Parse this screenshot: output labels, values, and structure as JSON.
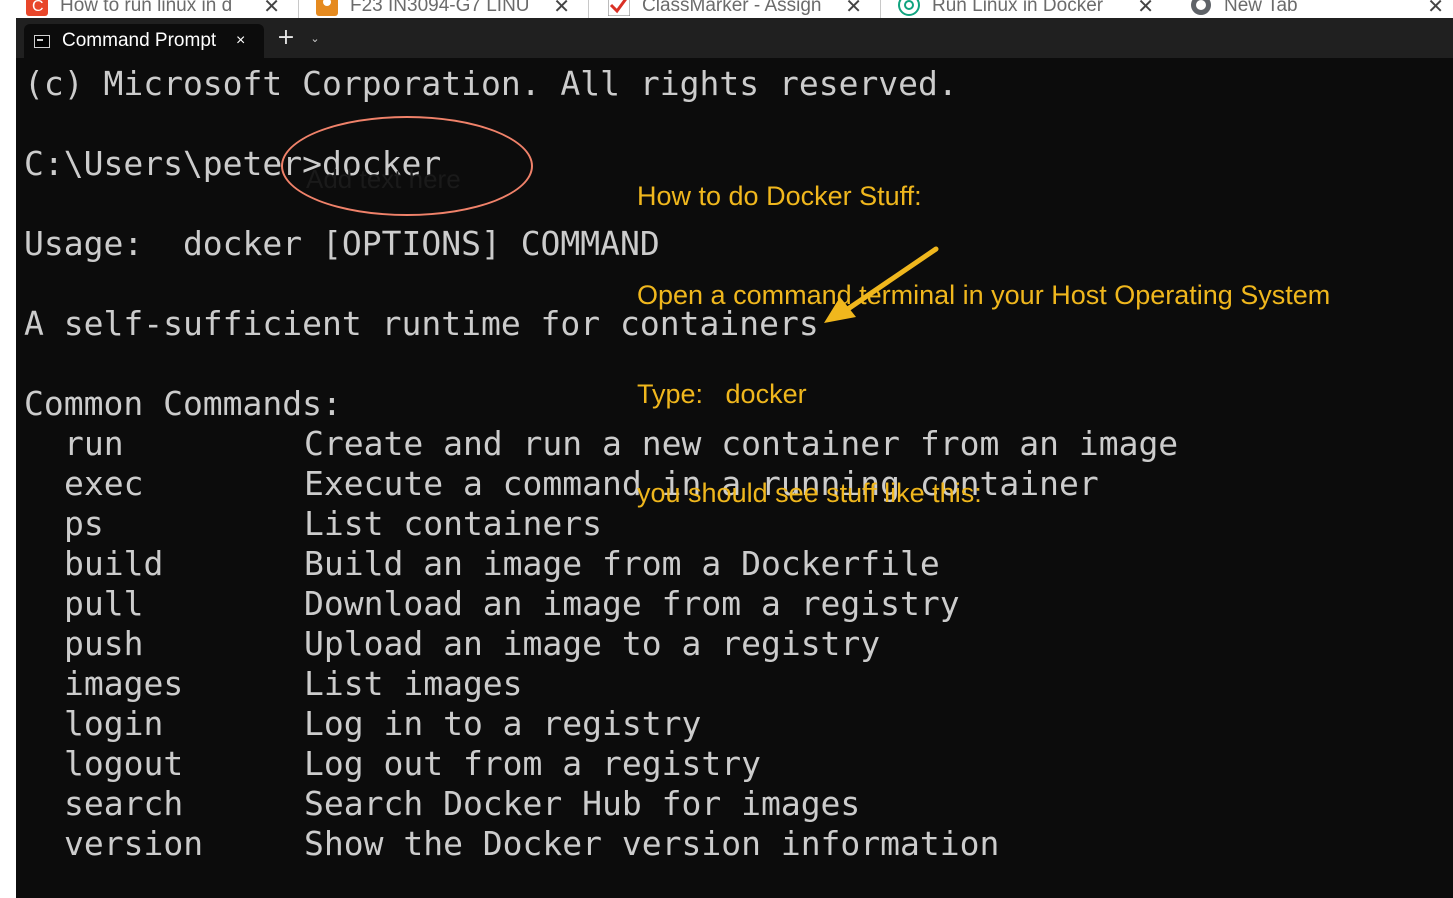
{
  "browser": {
    "tabs": [
      {
        "title": "How to run linux in d",
        "icon": "c-logo-icon",
        "color": "#e8462a"
      },
      {
        "title": "F23 IN3094-G7 LINU",
        "icon": "course-icon",
        "color": "#e58a1f"
      },
      {
        "title": "ClassMarker - Assign",
        "icon": "checkmark-icon",
        "color": "#d93025"
      },
      {
        "title": "Run Linux in Docker",
        "icon": "chatgpt-icon",
        "color": "#10a37f"
      },
      {
        "title": "New Tab",
        "icon": "globe-icon",
        "color": "#5f6368"
      }
    ],
    "close_glyph": "✕"
  },
  "terminal": {
    "tab_title": "Command Prompt",
    "tab_close": "×",
    "new_tab": "+",
    "dropdown": "⌄",
    "copyright": "(c) Microsoft Corporation. All rights reserved.",
    "prompt": "C:\\Users\\peter>docker",
    "usage": "Usage:  docker [OPTIONS] COMMAND",
    "tagline": "A self-sufficient runtime for containers",
    "section_header": "Common Commands:",
    "commands": [
      {
        "name": "run",
        "desc": "Create and run a new container from an image"
      },
      {
        "name": "exec",
        "desc": "Execute a command in a running container"
      },
      {
        "name": "ps",
        "desc": "List containers"
      },
      {
        "name": "build",
        "desc": "Build an image from a Dockerfile"
      },
      {
        "name": "pull",
        "desc": "Download an image from a registry"
      },
      {
        "name": "push",
        "desc": "Upload an image to a registry"
      },
      {
        "name": "images",
        "desc": "List images"
      },
      {
        "name": "login",
        "desc": "Log in to a registry"
      },
      {
        "name": "logout",
        "desc": "Log out from a registry"
      },
      {
        "name": "search",
        "desc": "Search Docker Hub for images"
      },
      {
        "name": "version",
        "desc": "Show the Docker version information"
      }
    ]
  },
  "annotation": {
    "placeholder": "Add text here",
    "note_lines": [
      "How to do Docker Stuff:",
      "Open a command terminal in your Host Operating System",
      "Type:   docker",
      "you should see stuff like this:"
    ],
    "note_color": "#f0b71d",
    "ellipse_color": "#f0826a"
  }
}
